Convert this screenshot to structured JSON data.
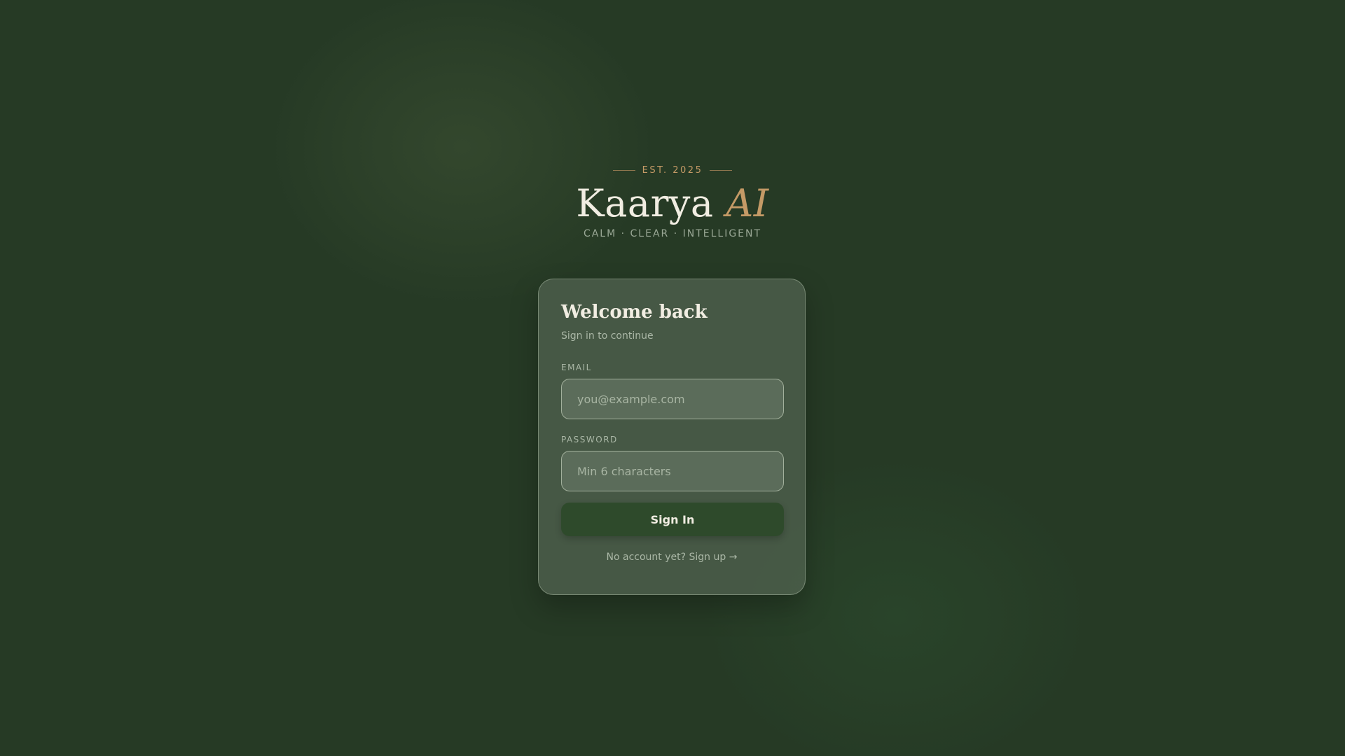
{
  "brand": {
    "est": "EST. 2025",
    "name": "Kaarya",
    "name_accent": "AI",
    "tagline": "CALM · CLEAR · INTELLIGENT"
  },
  "login": {
    "title": "Welcome back",
    "subtitle": "Sign in to continue",
    "email_label": "EMAIL",
    "email_placeholder": "you@example.com",
    "email_value": "",
    "password_label": "PASSWORD",
    "password_placeholder": "Min 6 characters",
    "password_value": "",
    "submit_label": "Sign In",
    "signup_prompt": "No account yet?",
    "signup_link": "Sign up →"
  },
  "colors": {
    "background": "#263a25",
    "accent_gold": "#c49a66",
    "button": "#2e4a2b",
    "text_light": "#f1ede2"
  }
}
